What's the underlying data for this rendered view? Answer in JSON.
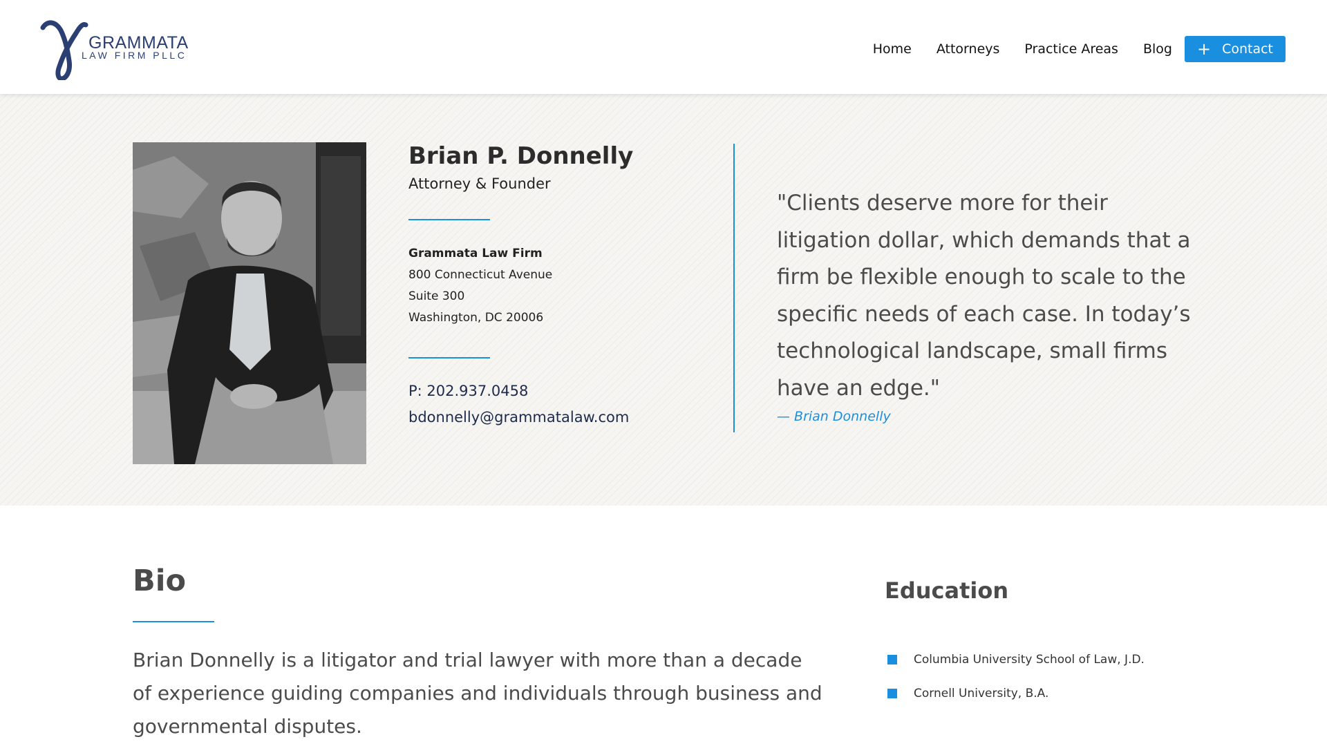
{
  "brand": {
    "name": "GRAMMATA",
    "subtitle": "LAW FIRM PLLC"
  },
  "nav": {
    "items": [
      {
        "label": "Home"
      },
      {
        "label": "Attorneys"
      },
      {
        "label": "Practice Areas"
      },
      {
        "label": "Blog"
      }
    ],
    "contact_label": "Contact",
    "contact_icon": "plus-icon"
  },
  "profile": {
    "name": "Brian P. Donnelly",
    "title": "Attorney & Founder",
    "firm": "Grammata Law Firm",
    "address_line1": "800 Connecticut Avenue",
    "address_line2": "Suite 300",
    "address_line3": "Washington, DC 20006",
    "phone": "P: 202.937.0458",
    "email": "bdonnelly@grammatalaw.com"
  },
  "quote": {
    "text": "\"Clients deserve more for their litigation dollar, which demands that a firm be flexible enough to scale to the specific needs of each case. In today’s technological landscape, small firms have an edge.\"",
    "author": "— Brian Donnelly"
  },
  "bio": {
    "heading": "Bio",
    "text": "Brian Donnelly is a litigator and trial lawyer with more than a decade of experience guiding companies and individuals through business and governmental disputes."
  },
  "education": {
    "heading": "Education",
    "items": [
      {
        "label": "Columbia University School of Law, J.D."
      },
      {
        "label": "Cornell University, B.A."
      }
    ]
  },
  "colors": {
    "accent": "#1b8fdf",
    "brand": "#2b3f73",
    "text": "#4b4b4b"
  }
}
